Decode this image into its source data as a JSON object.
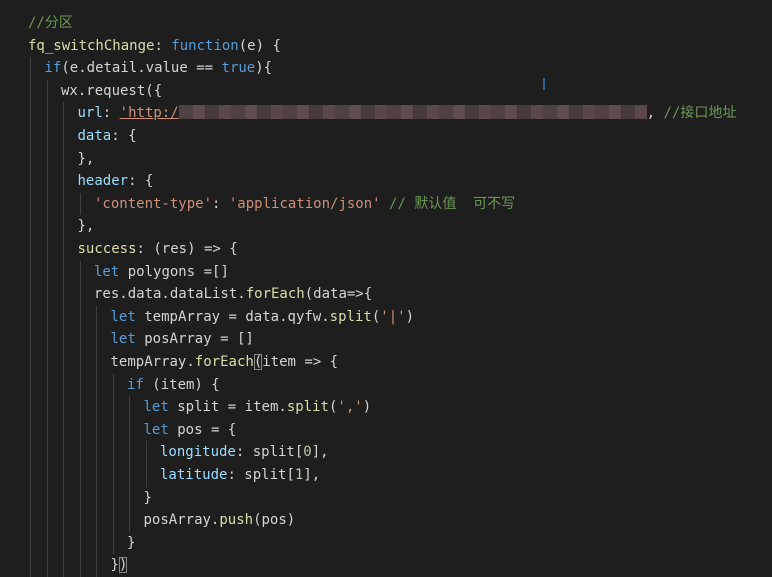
{
  "editor": {
    "theme": {
      "background": "#1e1e1e",
      "comment": "#6a9955",
      "keyword": "#569cd6",
      "function": "#dcdcaa",
      "string": "#ce9178",
      "property": "#9cdcfe",
      "number": "#b5cea8",
      "default": "#d4d4d4"
    },
    "lines": [
      {
        "indent": 0,
        "tokens": [
          {
            "t": "comment",
            "v": "//分区"
          }
        ]
      },
      {
        "indent": 0,
        "tokens": [
          {
            "t": "function",
            "v": "fq_switchChange"
          },
          {
            "t": "default",
            "v": ": "
          },
          {
            "t": "keyword",
            "v": "function"
          },
          {
            "t": "default",
            "v": "(e) {"
          }
        ]
      },
      {
        "indent": 1,
        "tokens": [
          {
            "t": "keyword",
            "v": "if"
          },
          {
            "t": "default",
            "v": "(e.detail.value == "
          },
          {
            "t": "keyword",
            "v": "true"
          },
          {
            "t": "default",
            "v": "){"
          }
        ]
      },
      {
        "indent": 2,
        "tokens": [
          {
            "t": "default",
            "v": "wx.request({"
          }
        ]
      },
      {
        "indent": 3,
        "tokens": [
          {
            "t": "property",
            "v": "url"
          },
          {
            "t": "default",
            "v": ": "
          },
          {
            "t": "url",
            "v": "'http:/"
          },
          {
            "t": "redacted",
            "v": ""
          },
          {
            "t": "default",
            "v": ", "
          },
          {
            "t": "comment",
            "v": "//接口地址"
          }
        ]
      },
      {
        "indent": 3,
        "tokens": [
          {
            "t": "property",
            "v": "data"
          },
          {
            "t": "default",
            "v": ": {"
          }
        ]
      },
      {
        "indent": 3,
        "tokens": [
          {
            "t": "default",
            "v": "},"
          }
        ]
      },
      {
        "indent": 3,
        "tokens": [
          {
            "t": "property",
            "v": "header"
          },
          {
            "t": "default",
            "v": ": {"
          }
        ]
      },
      {
        "indent": 4,
        "tokens": [
          {
            "t": "string",
            "v": "'content-type'"
          },
          {
            "t": "default",
            "v": ": "
          },
          {
            "t": "string",
            "v": "'application/json'"
          },
          {
            "t": "default",
            "v": " "
          },
          {
            "t": "comment",
            "v": "// 默认值  可不写"
          }
        ]
      },
      {
        "indent": 3,
        "tokens": [
          {
            "t": "default",
            "v": "},"
          }
        ]
      },
      {
        "indent": 3,
        "tokens": [
          {
            "t": "function",
            "v": "success"
          },
          {
            "t": "default",
            "v": ": (res) => {"
          }
        ]
      },
      {
        "indent": 4,
        "tokens": [
          {
            "t": "keyword",
            "v": "let"
          },
          {
            "t": "default",
            "v": " polygons =[]"
          }
        ]
      },
      {
        "indent": 4,
        "tokens": [
          {
            "t": "default",
            "v": "res.data.dataList."
          },
          {
            "t": "function",
            "v": "forEach"
          },
          {
            "t": "default",
            "v": "(data=>{"
          }
        ]
      },
      {
        "indent": 5,
        "tokens": [
          {
            "t": "keyword",
            "v": "let"
          },
          {
            "t": "default",
            "v": " tempArray = data.qyfw."
          },
          {
            "t": "function",
            "v": "split"
          },
          {
            "t": "default",
            "v": "("
          },
          {
            "t": "string",
            "v": "'|'"
          },
          {
            "t": "default",
            "v": ")"
          }
        ]
      },
      {
        "indent": 5,
        "tokens": [
          {
            "t": "keyword",
            "v": "let"
          },
          {
            "t": "default",
            "v": " posArray = []"
          }
        ]
      },
      {
        "indent": 5,
        "tokens": [
          {
            "t": "default",
            "v": "tempArray."
          },
          {
            "t": "function",
            "v": "forEach"
          },
          {
            "t": "bracket",
            "v": "("
          },
          {
            "t": "default",
            "v": "item => {"
          }
        ]
      },
      {
        "indent": 6,
        "tokens": [
          {
            "t": "keyword",
            "v": "if"
          },
          {
            "t": "default",
            "v": " (item) {"
          }
        ]
      },
      {
        "indent": 7,
        "tokens": [
          {
            "t": "keyword",
            "v": "let"
          },
          {
            "t": "default",
            "v": " split = item."
          },
          {
            "t": "function",
            "v": "split"
          },
          {
            "t": "default",
            "v": "("
          },
          {
            "t": "string",
            "v": "','"
          },
          {
            "t": "default",
            "v": ")"
          }
        ]
      },
      {
        "indent": 7,
        "tokens": [
          {
            "t": "keyword",
            "v": "let"
          },
          {
            "t": "default",
            "v": " pos = {"
          }
        ]
      },
      {
        "indent": 8,
        "tokens": [
          {
            "t": "property",
            "v": "longitude"
          },
          {
            "t": "default",
            "v": ": split["
          },
          {
            "t": "number",
            "v": "0"
          },
          {
            "t": "default",
            "v": "],"
          }
        ]
      },
      {
        "indent": 8,
        "tokens": [
          {
            "t": "property",
            "v": "latitude"
          },
          {
            "t": "default",
            "v": ": split["
          },
          {
            "t": "number",
            "v": "1"
          },
          {
            "t": "default",
            "v": "],"
          }
        ]
      },
      {
        "indent": 7,
        "tokens": [
          {
            "t": "default",
            "v": "}"
          }
        ]
      },
      {
        "indent": 7,
        "tokens": [
          {
            "t": "default",
            "v": "posArray."
          },
          {
            "t": "function",
            "v": "push"
          },
          {
            "t": "default",
            "v": "(pos)"
          }
        ]
      },
      {
        "indent": 6,
        "tokens": [
          {
            "t": "default",
            "v": "}"
          }
        ]
      },
      {
        "indent": 5,
        "tokens": [
          {
            "t": "default",
            "v": "}"
          },
          {
            "t": "bracket",
            "v": ")"
          }
        ]
      }
    ]
  }
}
